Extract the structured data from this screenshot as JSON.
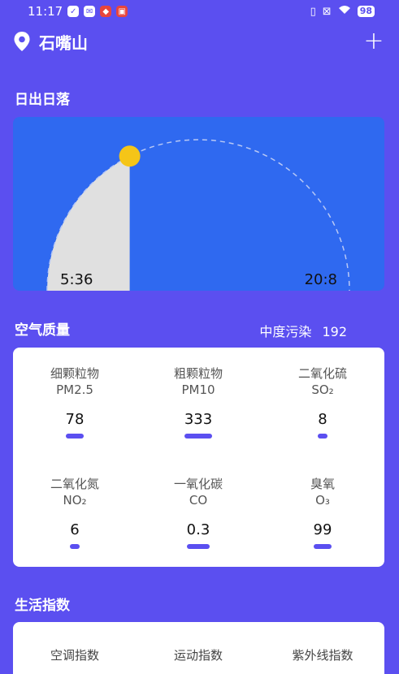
{
  "status_bar": {
    "time": "11:17",
    "battery": "98",
    "icons": [
      "check-circle-icon",
      "mail-icon",
      "app-badge-icon",
      "news-icon",
      "vibrate-icon",
      "no-sim-icon",
      "wifi-icon"
    ]
  },
  "header": {
    "city": "石嘴山",
    "location_icon": "location-pin-icon",
    "add_label": "+"
  },
  "sun": {
    "section_title": "日出日落",
    "sunrise": "5:36",
    "sunset": "20:8",
    "progress": 0.35,
    "colors": {
      "sky": "#2f69f0",
      "elapsed": "#e0e0e0",
      "sun": "#f5c518"
    }
  },
  "air_quality": {
    "section_title": "空气质量",
    "level": "中度污染",
    "aqi": "192",
    "items": [
      {
        "name": "细颗粒物",
        "formula": "PM2.5",
        "value": "78"
      },
      {
        "name": "粗颗粒物",
        "formula": "PM10",
        "value": "333"
      },
      {
        "name": "二氧化硫",
        "formula": "SO₂",
        "value": "8"
      },
      {
        "name": "二氧化氮",
        "formula": "NO₂",
        "value": "6"
      },
      {
        "name": "一氧化碳",
        "formula": "CO",
        "value": "0.3"
      },
      {
        "name": "臭氧",
        "formula": "O₃",
        "value": "99"
      }
    ]
  },
  "life_index": {
    "section_title": "生活指数",
    "items": [
      {
        "label": "空调指数"
      },
      {
        "label": "运动指数"
      },
      {
        "label": "紫外线指数"
      }
    ]
  },
  "colors": {
    "background": "#5b4ff0",
    "accent": "#5b4ff0",
    "card": "#ffffff"
  }
}
